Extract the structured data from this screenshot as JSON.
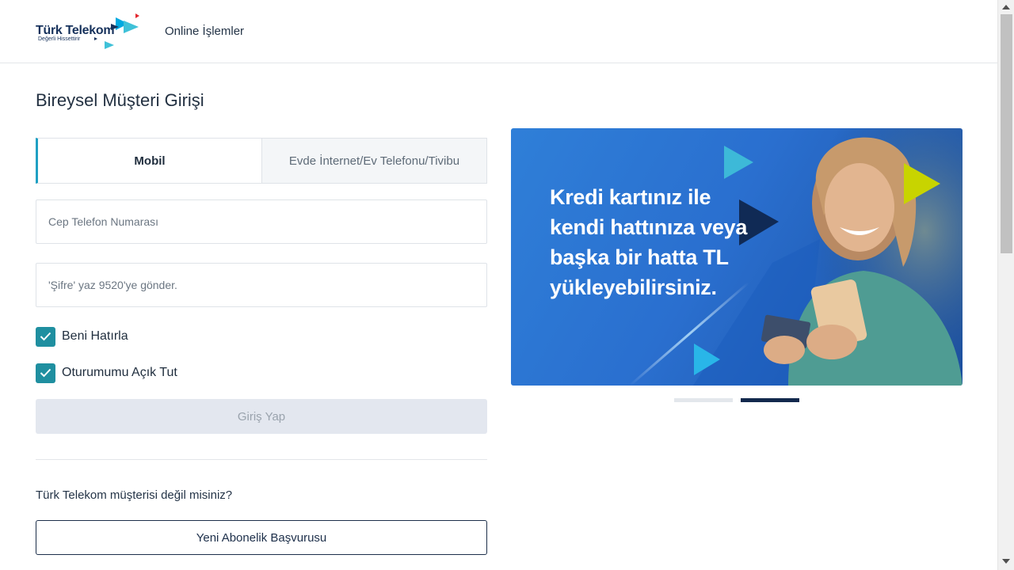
{
  "header": {
    "logo_word": "Türk Telekom",
    "logo_tagline": "Değerli Hissettirir",
    "nav_label": "Online İşlemler"
  },
  "page": {
    "title": "Bireysel Müşteri Girişi"
  },
  "tabs": [
    {
      "label": "Mobil",
      "active": true
    },
    {
      "label": "Evde İnternet/Ev Telefonu/Tivibu",
      "active": false
    }
  ],
  "form": {
    "phone_placeholder": "Cep Telefon Numarası",
    "password_placeholder": "'Şifre' yaz 9520'ye gönder.",
    "remember_label": "Beni Hatırla",
    "remember_checked": true,
    "keep_session_label": "Oturumumu Açık Tut",
    "keep_session_checked": true,
    "login_label": "Giriş Yap"
  },
  "signup": {
    "question": "Türk Telekom müşterisi değil misiniz?",
    "button_label": "Yeni Abonelik Başvurusu"
  },
  "banner": {
    "text": "Kredi kartınız ile kendi hattınıza veya başka bir hatta TL yükleyebilirsiniz.",
    "slide_count": 2,
    "active_slide": 2
  },
  "colors": {
    "brand_navy": "#17325c",
    "accent_teal": "#1f8fa0",
    "tab_accent": "#1fa0c3",
    "banner_blue": "#2a6fcf"
  }
}
